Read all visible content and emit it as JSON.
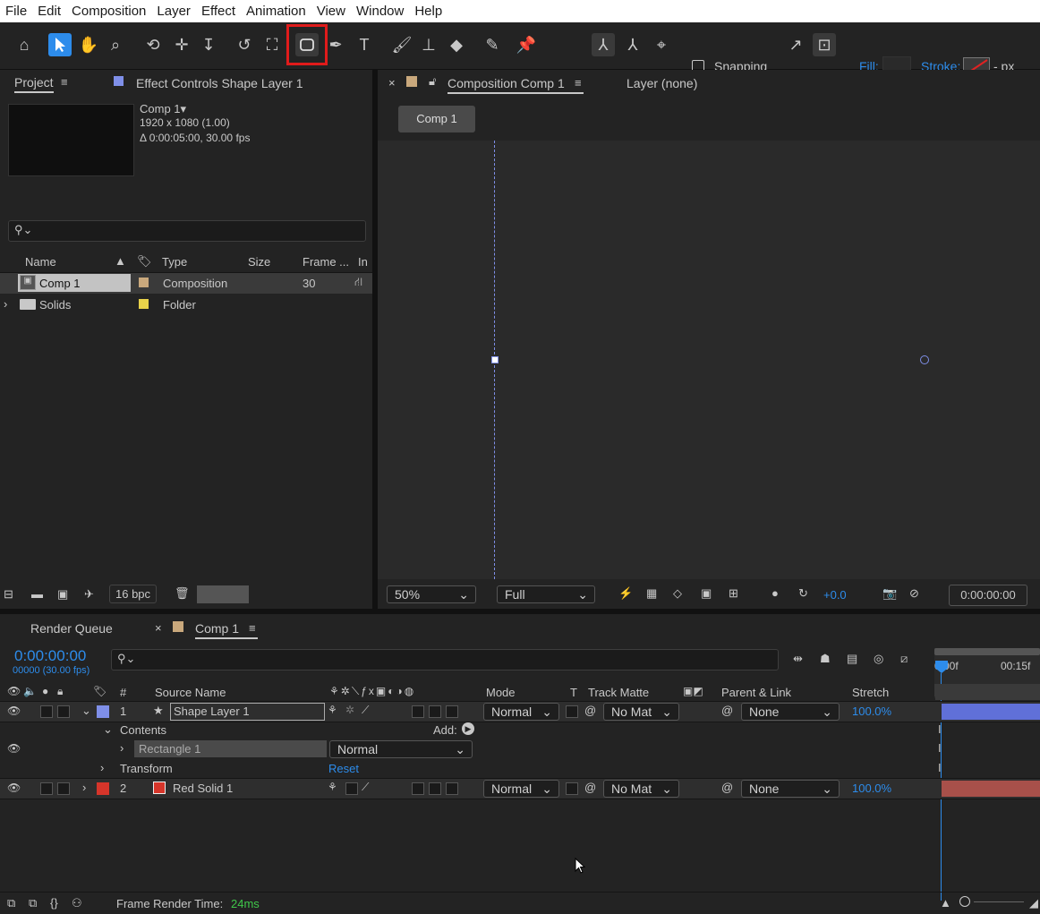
{
  "menu": [
    "File",
    "Edit",
    "Composition",
    "Layer",
    "Effect",
    "Animation",
    "View",
    "Window",
    "Help"
  ],
  "toolbar": {
    "snapping_label": "Snapping",
    "fill_label": "Fill:",
    "stroke_label": "Stroke:",
    "stroke_unit": "- px"
  },
  "project": {
    "tab_project": "Project",
    "tab_effect": "Effect Controls Shape Layer 1",
    "comp_name": "Comp 1▾",
    "comp_res": "1920 x 1080 (1.00)",
    "comp_dur": "Δ 0:00:05:00, 30.00 fps",
    "search_placeholder": "",
    "columns": [
      "Name",
      "Type",
      "Size",
      "Frame ...",
      "In"
    ],
    "items": [
      {
        "name": "Comp 1",
        "type": "Composition",
        "size": "",
        "frame": "30",
        "color": "#c9a87c"
      },
      {
        "name": "Solids",
        "type": "Folder",
        "size": "",
        "frame": "",
        "color": "#e8d24a"
      }
    ],
    "bpc": "16 bpc"
  },
  "composition": {
    "tab_label": "Composition Comp 1",
    "layer_tab": "Layer (none)",
    "breadcrumb": "Comp 1",
    "zoom": "50%",
    "quality": "Full",
    "exposure": "+0.0",
    "timecode": "0:00:00:00"
  },
  "timeline": {
    "tab_render": "Render Queue",
    "tab_comp": "Comp 1",
    "timecode": "0:00:00:00",
    "frames": "00000 (30.00 fps)",
    "ruler": [
      "0:00f",
      "00:15f"
    ],
    "headers": {
      "num": "#",
      "source": "Source Name",
      "mode": "Mode",
      "t": "T",
      "matte": "Track Matte",
      "parent": "Parent & Link",
      "stretch": "Stretch"
    },
    "layers": [
      {
        "num": "1",
        "name": "Shape Layer 1",
        "mode": "Normal",
        "matte": "No Mat",
        "parent": "None",
        "stretch": "100.0%",
        "color": "#7f8fe8"
      },
      {
        "num": "2",
        "name": "Red Solid 1",
        "mode": "Normal",
        "matte": "No Mat",
        "parent": "None",
        "stretch": "100.0%",
        "color": "#d6352a"
      }
    ],
    "contents_label": "Contents",
    "add_label": "Add:",
    "rect_label": "Rectangle 1",
    "rect_mode": "Normal",
    "transform_label": "Transform",
    "reset_label": "Reset",
    "render_time_label": "Frame Render Time:",
    "render_time_value": "24ms"
  }
}
